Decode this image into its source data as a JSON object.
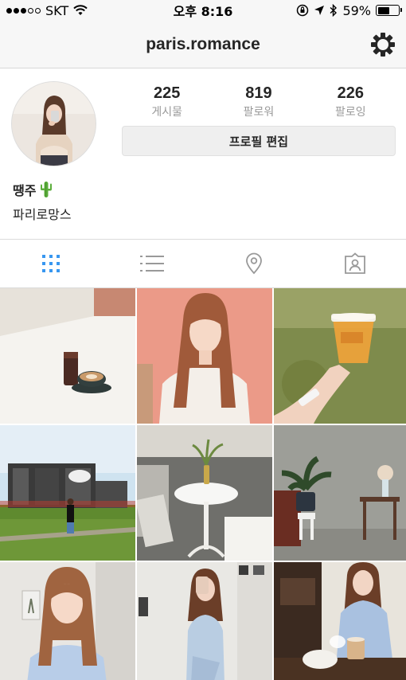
{
  "status_bar": {
    "carrier": "SKT",
    "time": "오후 8:16",
    "battery": "59%",
    "battery_level": 0.59
  },
  "nav": {
    "title": "paris.romance"
  },
  "profile": {
    "stats": [
      {
        "value": "225",
        "label": "게시물"
      },
      {
        "value": "819",
        "label": "팔로워"
      },
      {
        "value": "226",
        "label": "팔로잉"
      }
    ],
    "edit_button": "프로필 편집",
    "display_name": "땡주",
    "bio": "파리로망스"
  },
  "tabs": [
    "grid-view",
    "list-view",
    "location-view",
    "tagged-view"
  ],
  "grid": {
    "posts": [
      {
        "name": "post-cafe-latte"
      },
      {
        "name": "post-portrait-pink-wall"
      },
      {
        "name": "post-beer-cup"
      },
      {
        "name": "post-festival-stage"
      },
      {
        "name": "post-white-table-vase"
      },
      {
        "name": "post-plant-stool"
      },
      {
        "name": "post-portrait-blue-dress"
      },
      {
        "name": "post-mirror-selfie"
      },
      {
        "name": "post-cafe-dress"
      }
    ]
  },
  "colors": {
    "accent": "#3897f0",
    "tab_inactive": "#999999",
    "bar_bg": "#f7f7f7"
  }
}
